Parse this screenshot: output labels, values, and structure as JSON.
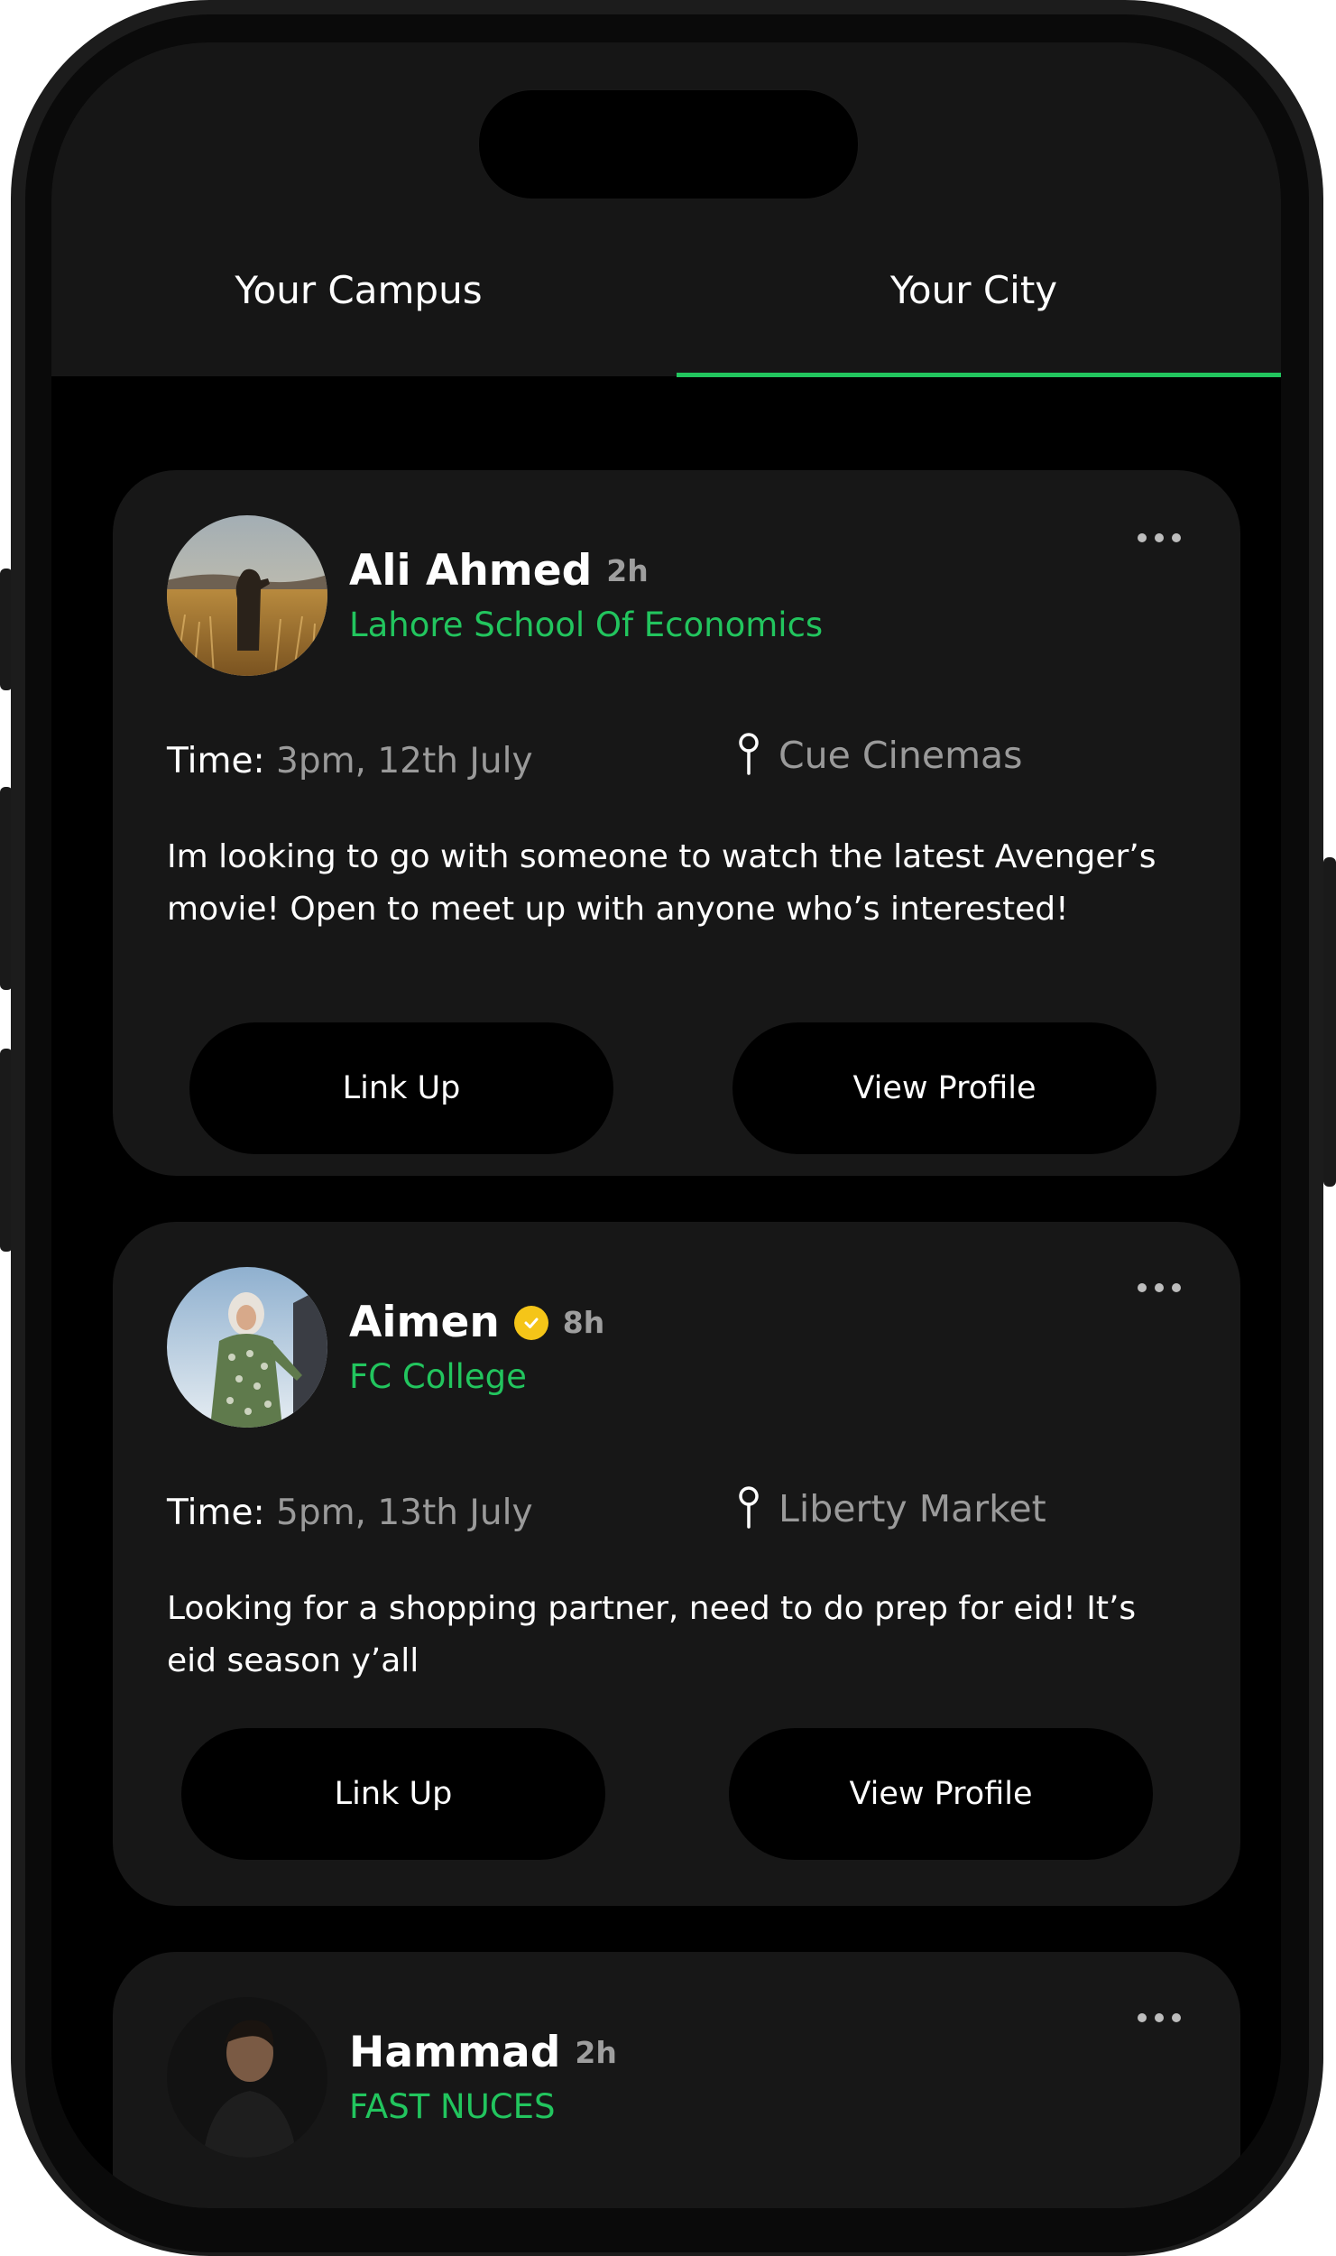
{
  "tabs": [
    {
      "label": "Your Campus",
      "active": false
    },
    {
      "label": "Your City",
      "active": true
    }
  ],
  "accent_color": "#22c55e",
  "posts": [
    {
      "name": "Ali Ahmed",
      "time_ago": "2h",
      "verified": false,
      "school": "Lahore School Of Economics",
      "time_label": "Time:",
      "time_value": "3pm, 12th July",
      "location": "Cue Cinemas",
      "description": "Im looking to go with someone to watch the latest Avenger’s movie! Open to meet up with anyone who’s interested!",
      "link_up_label": "Link Up",
      "view_profile_label": "View Profile"
    },
    {
      "name": "Aimen",
      "time_ago": "8h",
      "verified": true,
      "school": "FC College",
      "time_label": "Time:",
      "time_value": "5pm, 13th July",
      "location": "Liberty Market",
      "description": "Looking for a shopping partner, need to do prep for eid! It’s eid season y’all",
      "link_up_label": "Link Up",
      "view_profile_label": "View Profile"
    },
    {
      "name": "Hammad",
      "time_ago": "2h",
      "verified": false,
      "school": "FAST NUCES"
    }
  ]
}
